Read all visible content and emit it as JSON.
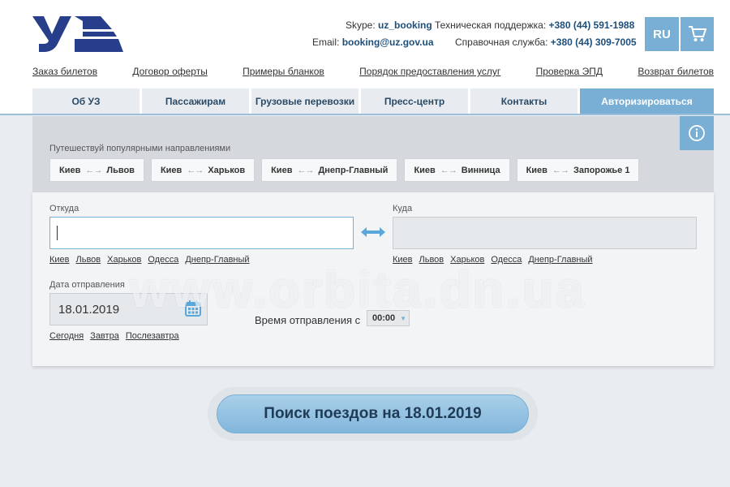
{
  "header": {
    "skype_label": "Skype:",
    "skype_value": "uz_booking",
    "email_label": "Email:",
    "email_value": "booking@uz.gov.ua",
    "support_label": "Техническая поддержка:",
    "support_phone": "+380 (44) 591-1988",
    "info_label": "Справочная служба:",
    "info_phone": "+380 (44) 309-7005",
    "lang": "RU",
    "brand_color": "#273f8a",
    "accent_color": "#7aafd5"
  },
  "links": [
    "Заказ билетов",
    "Договор оферты",
    "Примеры бланков",
    "Порядок предоставления услуг",
    "Проверка ЭПД",
    "Возврат билетов"
  ],
  "nav": {
    "tabs": [
      "Об УЗ",
      "Пассажирам",
      "Грузовые перевозки",
      "Пресс-центр",
      "Контакты"
    ],
    "auth_label": "Авторизироваться"
  },
  "popular": {
    "title": "Путешествуй популярными направлениями",
    "routes": [
      {
        "from": "Киев",
        "to": "Львов"
      },
      {
        "from": "Киев",
        "to": "Харьков"
      },
      {
        "from": "Киев",
        "to": "Днепр-Главный"
      },
      {
        "from": "Киев",
        "to": "Винница"
      },
      {
        "from": "Киев",
        "to": "Запорожье 1"
      }
    ]
  },
  "form": {
    "from_label": "Откуда",
    "from_value": "",
    "to_label": "Куда",
    "to_value": "",
    "quick_cities": [
      "Киев",
      "Львов",
      "Харьков",
      "Одесса",
      "Днепр-Главный"
    ],
    "date_label": "Дата отправления",
    "date_value": "18.01.2019",
    "quick_dates": [
      "Сегодня",
      "Завтра",
      "Послезавтра"
    ],
    "time_label": "Время отправления с",
    "time_value": "00:00"
  },
  "watermark": "www.orbita.dn.ua",
  "search_button": "Поиск поездов на 18.01.2019",
  "icons": {
    "logo": "uz-logo",
    "cart": "cart-icon",
    "info": "info-icon",
    "swap": "swap-arrows-icon",
    "calendar": "calendar-icon",
    "route_arrow": "bidirectional-arrow-icon"
  }
}
